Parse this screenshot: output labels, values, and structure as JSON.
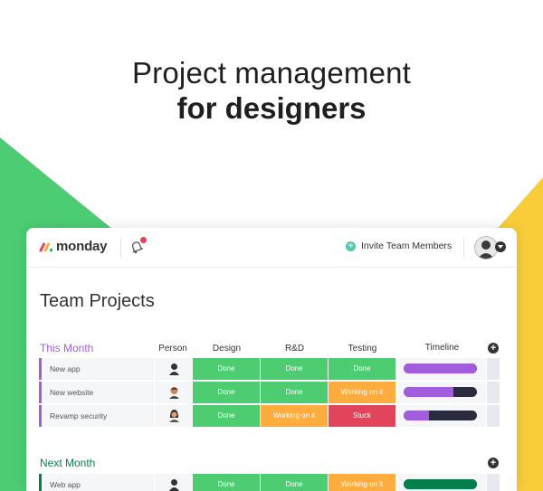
{
  "hero": {
    "line1": "Project management",
    "line2": "for designers"
  },
  "colors": {
    "green_accent": "#4ccd73",
    "yellow_accent": "#f9cd3a",
    "done": "#4dcc71",
    "working": "#fdac3d",
    "stuck": "#e2445c",
    "purple": "#a25ddc",
    "dark_green": "#037f4c"
  },
  "app": {
    "logo_text": "monday",
    "invite_label": "Invite Team Members",
    "board_title": "Team Projects",
    "icons": {
      "bell": "bell-icon",
      "invite_plus": "plus-circle-icon",
      "avatar": "user-avatar",
      "caret": "chevron-down-icon",
      "add_column": "plus-circle-icon"
    }
  },
  "columns": [
    "Person",
    "Design",
    "R&D",
    "Testing",
    "Timeline"
  ],
  "groups": [
    {
      "title": "This Month",
      "color": "#a25ddc",
      "rows": [
        {
          "name": "New app",
          "design": "Done",
          "rd": "Done",
          "testing": "Done",
          "timeline_progress": 1.0
        },
        {
          "name": "New website",
          "design": "Done",
          "rd": "Done",
          "testing": "Working on it",
          "timeline_progress": 0.68
        },
        {
          "name": "Revamp security",
          "design": "Done",
          "rd": "Working on it",
          "testing": "Stuck",
          "timeline_progress": 0.35
        }
      ]
    },
    {
      "title": "Next Month",
      "color": "#037f4c",
      "rows": [
        {
          "name": "Web app",
          "design": "Done",
          "rd": "Done",
          "testing": "Working on it",
          "timeline_progress": 1.0
        }
      ]
    }
  ]
}
